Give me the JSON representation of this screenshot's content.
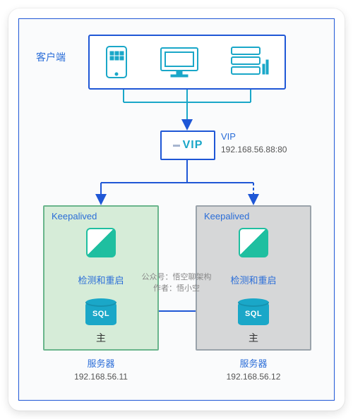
{
  "client_label": "客户端",
  "vip": {
    "label": "VIP",
    "title": "VIP",
    "address": "192.168.56.88:80"
  },
  "credit": {
    "line1": "公众号：悟空聊架构",
    "line2": "作者：悟小空"
  },
  "servers": {
    "left": {
      "keepalived": "Keepalived",
      "check": "检测和重启",
      "db": "SQL",
      "role": "主",
      "name": "服务器",
      "ip": "192.168.56.11"
    },
    "right": {
      "keepalived": "Keepalived",
      "check": "检测和重启",
      "db": "SQL",
      "role": "主",
      "name": "服务器",
      "ip": "192.168.56.12"
    }
  }
}
